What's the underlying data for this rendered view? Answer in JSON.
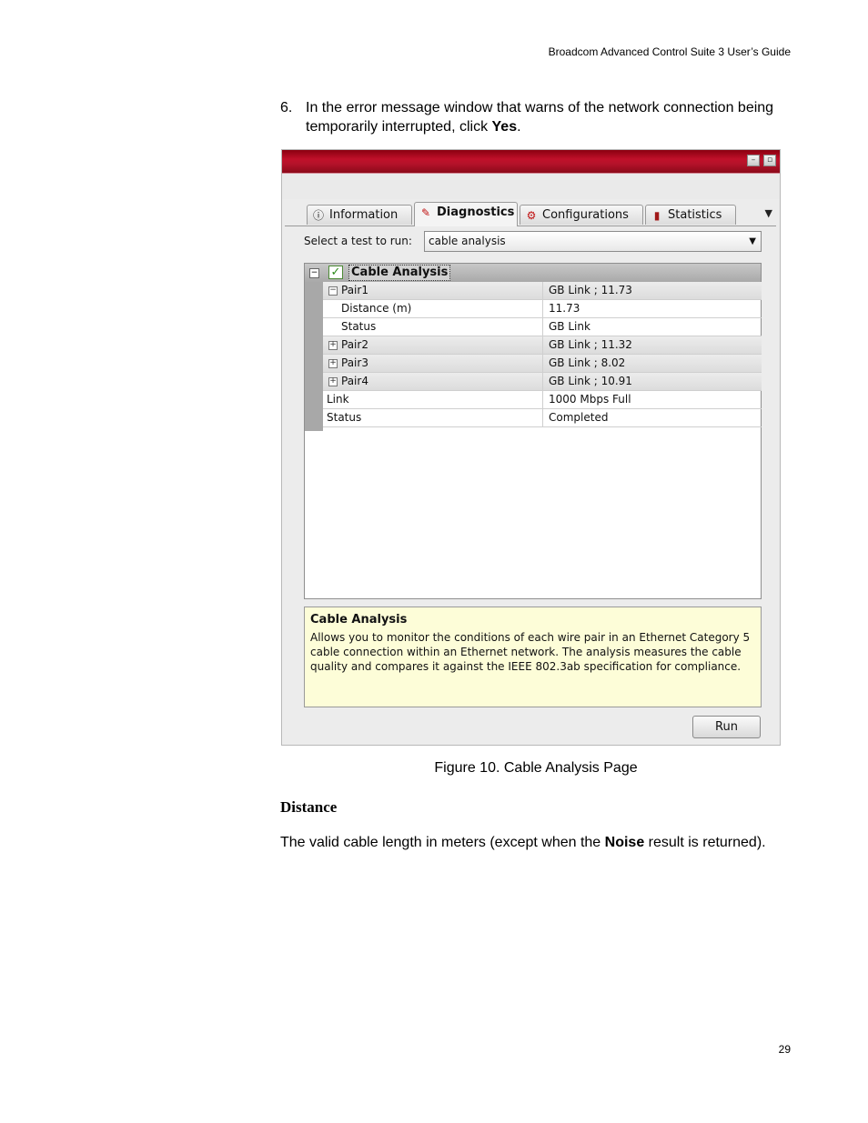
{
  "page": {
    "header": "Broadcom Advanced Control Suite 3 User’s Guide",
    "page_number": "29",
    "step_number": "6.",
    "step_text_1": "In the error message window that warns of the network connection being temporarily interrupted, click ",
    "step_bold": "Yes",
    "step_text_2": ".",
    "caption": "Figure 10. Cable Analysis Page",
    "section_title": "Distance",
    "para_text_1": "The valid cable length in meters (except when the ",
    "para_bold": "Noise",
    "para_text_2": " result is returned)."
  },
  "app": {
    "tabs": [
      {
        "label": "Information",
        "icon": "info-icon",
        "active": false
      },
      {
        "label": "Diagnostics",
        "icon": "wrench-icon",
        "active": true
      },
      {
        "label": "Configurations",
        "icon": "config-icon",
        "active": false
      },
      {
        "label": "Statistics",
        "icon": "chart-icon",
        "active": false
      }
    ],
    "select_label": "Select a test to run:",
    "select_value": "cable analysis",
    "grid_title": "Cable Analysis",
    "rows": [
      {
        "name": "Pair1",
        "value": "GB Link ; 11.73",
        "expander": "⊟",
        "indent": 1
      },
      {
        "name": "Distance (m)",
        "value": "11.73",
        "expander": "",
        "indent": 2
      },
      {
        "name": "Status",
        "value": "GB Link",
        "expander": "",
        "indent": 2
      },
      {
        "name": "Pair2",
        "value": "GB Link ; 11.32",
        "expander": "⊞",
        "indent": 1
      },
      {
        "name": "Pair3",
        "value": "GB Link ; 8.02",
        "expander": "⊞",
        "indent": 1
      },
      {
        "name": "Pair4",
        "value": "GB Link ; 10.91",
        "expander": "⊞",
        "indent": 1
      },
      {
        "name": "Link",
        "value": "1000 Mbps Full",
        "expander": "",
        "indent": 0
      },
      {
        "name": "Status",
        "value": "Completed",
        "expander": "",
        "indent": 0
      }
    ],
    "info_title": "Cable Analysis",
    "info_text": "Allows you to monitor the conditions of each wire pair in an Ethernet Category 5 cable connection within an Ethernet network. The analysis measures the cable quality and compares it against the IEEE 802.3ab specification for compliance.",
    "run_label": "Run"
  }
}
